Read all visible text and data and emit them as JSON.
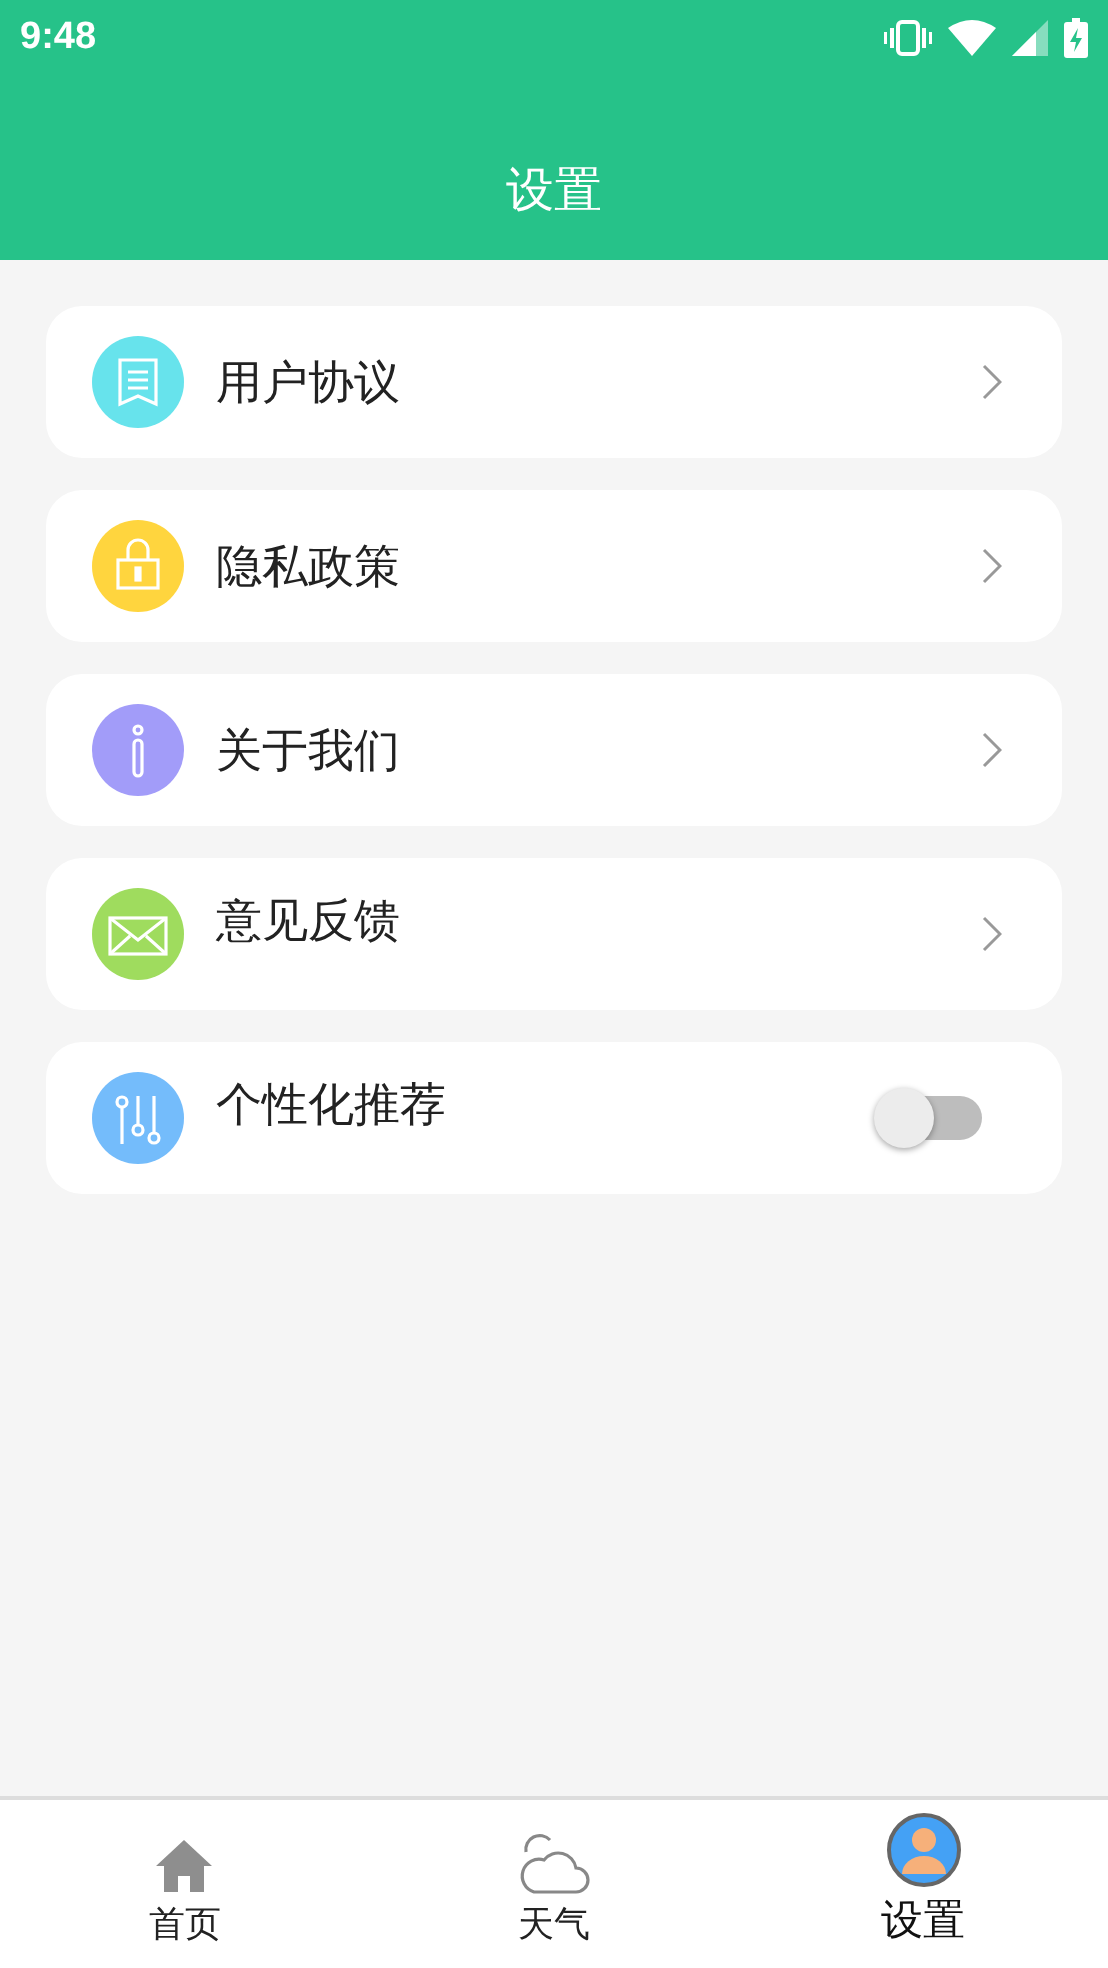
{
  "status_bar": {
    "time": "9:48"
  },
  "header": {
    "title": "设置"
  },
  "items": [
    {
      "kind": "link",
      "label": "用户协议",
      "color": "#67e3ec"
    },
    {
      "kind": "link",
      "label": "隐私政策",
      "color": "#ffd53e"
    },
    {
      "kind": "link",
      "label": "关于我们",
      "color": "#a29cf9"
    },
    {
      "kind": "link",
      "label": "意见反馈",
      "color": "#9fdc5e"
    },
    {
      "kind": "toggle",
      "label": "个性化推荐",
      "color": "#74bcfb",
      "on": false
    }
  ],
  "tabs": [
    {
      "label": "首页",
      "selected": false
    },
    {
      "label": "天气",
      "selected": false
    },
    {
      "label": "设置",
      "selected": true
    }
  ]
}
